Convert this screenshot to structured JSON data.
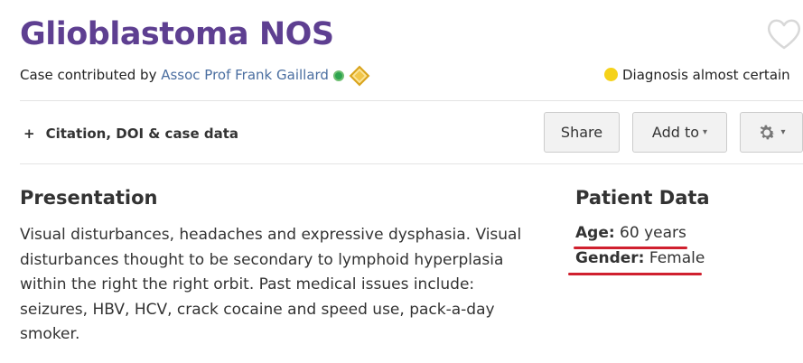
{
  "case": {
    "title": "Glioblastoma NOS",
    "byline_prefix": "Case contributed by ",
    "contributor": "Assoc Prof Frank Gaillard",
    "diagnosis_certainty": "Diagnosis almost certain"
  },
  "toolbar": {
    "citation_plus": "+",
    "citation_label": "Citation, DOI & case data",
    "share_label": "Share",
    "add_to_label": "Add to",
    "caret": "▾"
  },
  "presentation": {
    "heading": "Presentation",
    "text": "Visual disturbances, headaches and expressive dysphasia. Visual disturbances thought to be secondary to lymphoid hyperplasia within the right the right orbit. Past medical issues include: seizures, HBV, HCV, crack cocaine and speed use, pack-a-day smoker."
  },
  "patient_data": {
    "heading": "Patient Data",
    "age_label": "Age:",
    "age_value": " 60 years",
    "gender_label": "Gender:",
    "gender_value": " Female"
  },
  "colors": {
    "title": "#5e3f91",
    "link": "#4a6ea0",
    "certainty_dot": "#f5d21a",
    "annotation_underline": "#d0202e"
  },
  "icons": {
    "favorite": "heart-icon",
    "contributor_status": "green-dot-icon",
    "contributor_badge": "diamond-badge-icon",
    "settings": "gear-icon"
  }
}
